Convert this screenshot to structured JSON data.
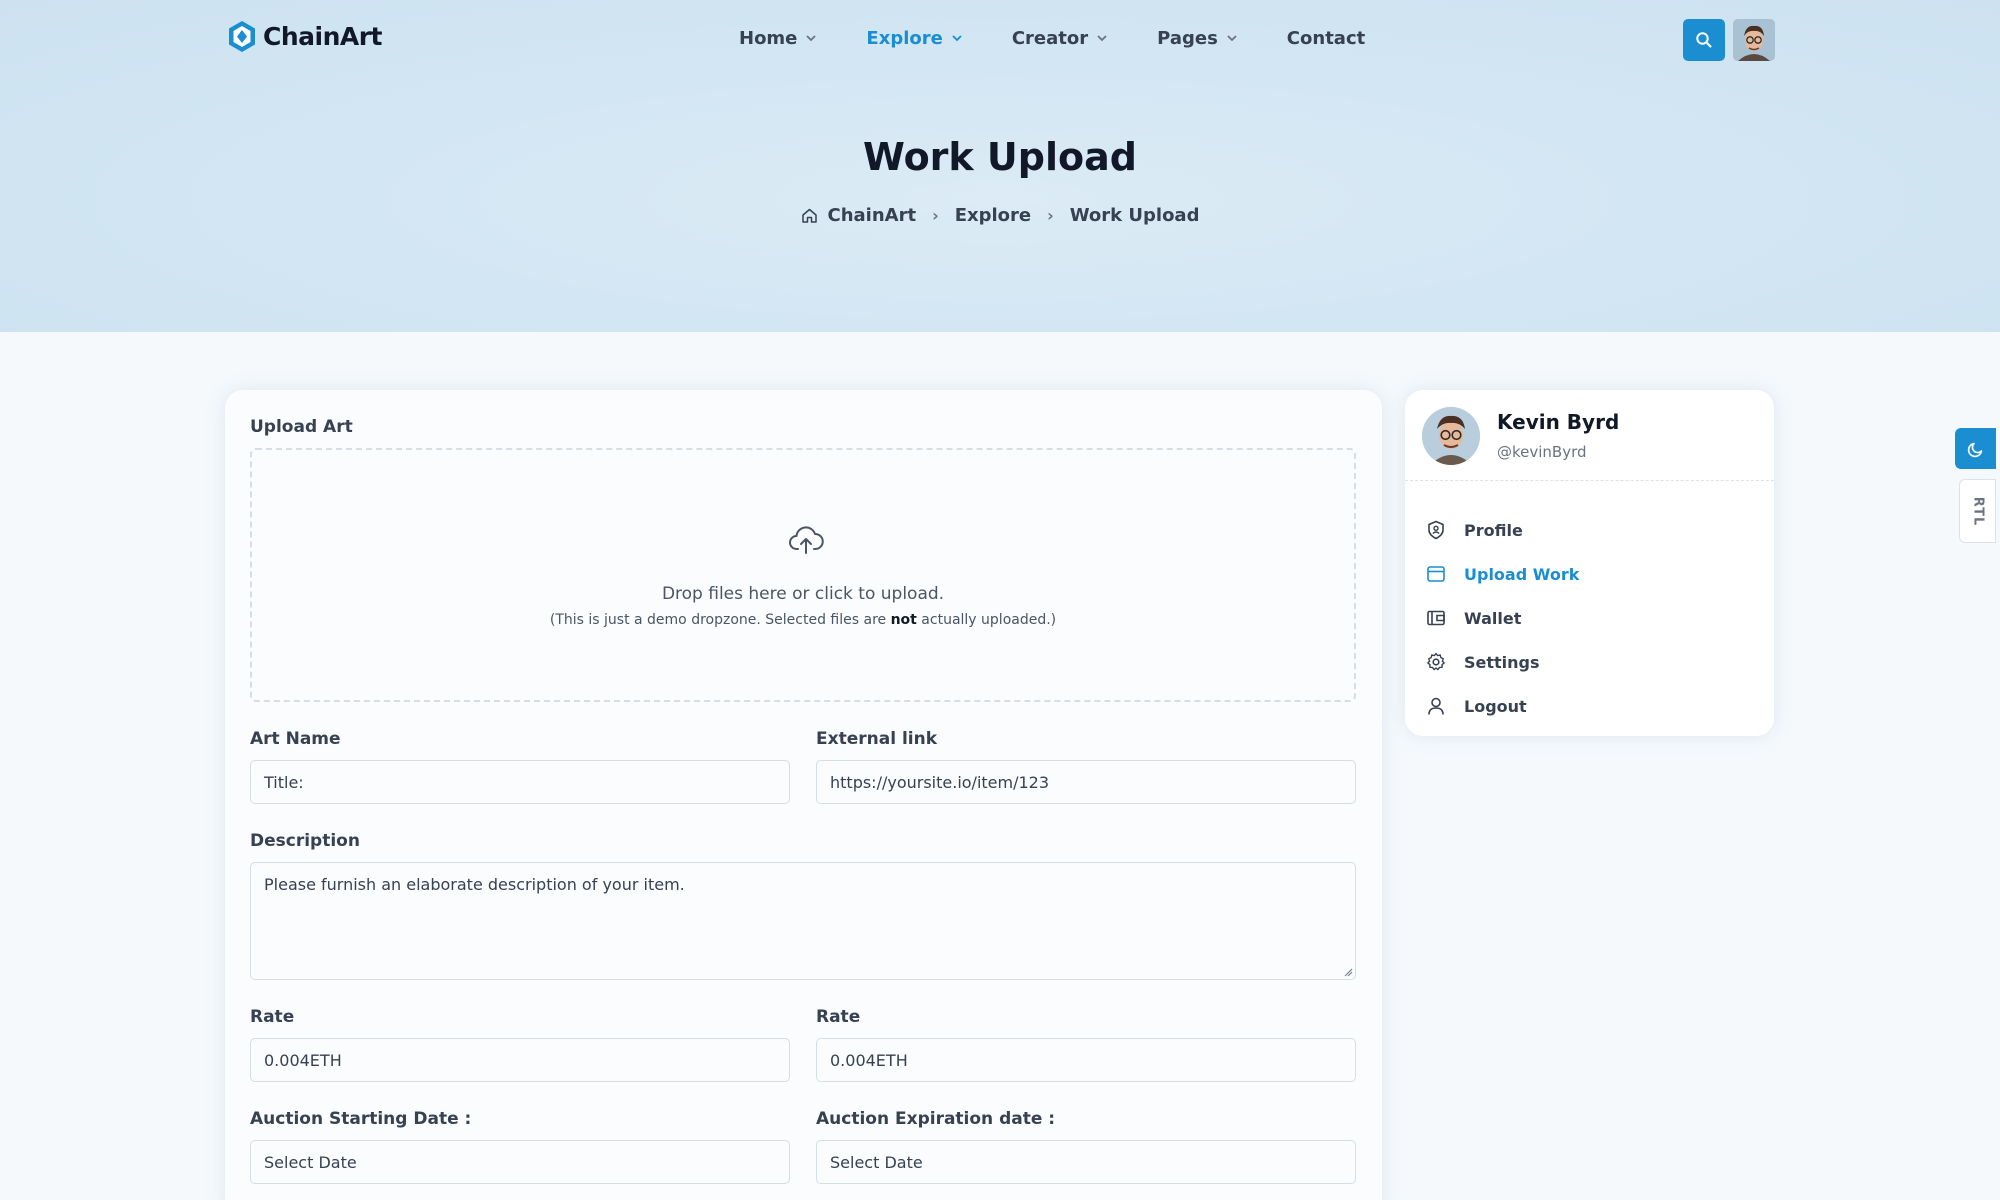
{
  "brand": {
    "name": "ChainArt",
    "accent": "#1a8ed1"
  },
  "nav": {
    "items": [
      {
        "label": "Home",
        "has_dropdown": true,
        "active": false
      },
      {
        "label": "Explore",
        "has_dropdown": true,
        "active": true
      },
      {
        "label": "Creator",
        "has_dropdown": true,
        "active": false
      },
      {
        "label": "Pages",
        "has_dropdown": true,
        "active": false
      },
      {
        "label": "Contact",
        "has_dropdown": false,
        "active": false
      }
    ]
  },
  "hero": {
    "title": "Work Upload",
    "breadcrumb": [
      "ChainArt",
      "Explore",
      "Work Upload"
    ]
  },
  "form": {
    "upload_label": "Upload Art",
    "dropzone_text": "Drop files here or click to upload.",
    "dropzone_sub_before": "(This is just a demo dropzone. Selected files are ",
    "dropzone_sub_bold": "not",
    "dropzone_sub_after": " actually uploaded.)",
    "art_name_label": "Art Name",
    "art_name_placeholder": "Title:",
    "external_link_label": "External link",
    "external_link_placeholder": "https://yoursite.io/item/123",
    "description_label": "Description",
    "description_placeholder": "Please furnish an elaborate description of your item.",
    "rate_label_1": "Rate",
    "rate_value_1": "0.004ETH",
    "rate_label_2": "Rate",
    "rate_value_2": "0.004ETH",
    "start_date_label": "Auction Starting Date :",
    "start_date_placeholder": "Select Date",
    "end_date_label": "Auction Expiration date :",
    "end_date_placeholder": "Select Date"
  },
  "profile": {
    "name": "Kevin Byrd",
    "handle": "@kevinByrd",
    "menu": [
      {
        "label": "Profile",
        "icon": "shield-user-icon",
        "active": false
      },
      {
        "label": "Upload Work",
        "icon": "browser-window-icon",
        "active": true
      },
      {
        "label": "Wallet",
        "icon": "wallet-icon",
        "active": false
      },
      {
        "label": "Settings",
        "icon": "gear-icon",
        "active": false
      },
      {
        "label": "Logout",
        "icon": "user-icon",
        "active": false
      }
    ]
  },
  "toggles": {
    "rtl_label": "RTL"
  }
}
